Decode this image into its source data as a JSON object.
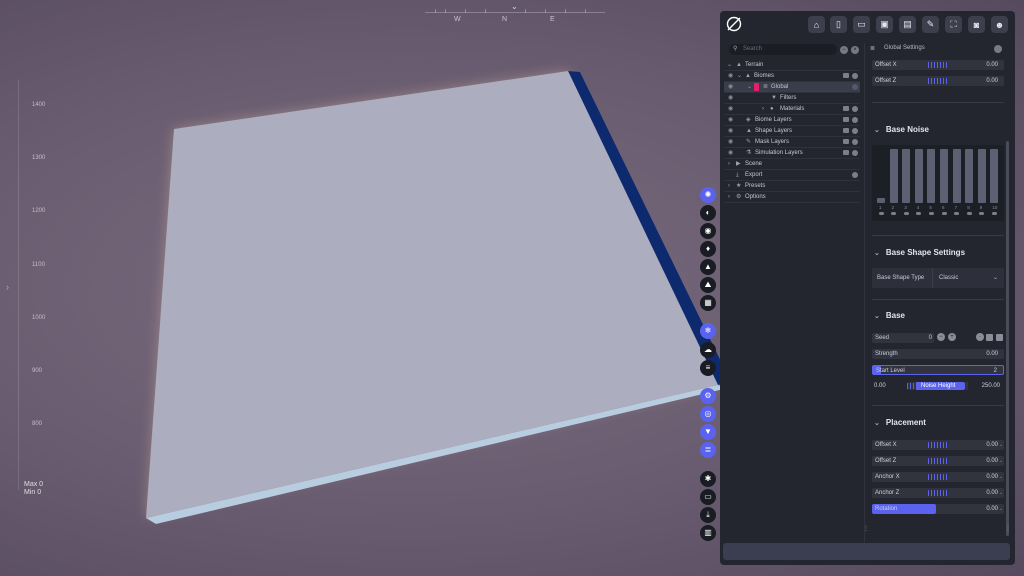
{
  "viewport": {
    "compass": {
      "west": "W",
      "north": "N",
      "east": "E"
    },
    "elevation_ticks": [
      "1400",
      "1300",
      "1200",
      "1100",
      "1000",
      "900",
      "800"
    ],
    "max_label": "Max 0",
    "min_label": "Min 0"
  },
  "search": {
    "placeholder": "Search"
  },
  "tree": {
    "items": [
      {
        "label": "Terrain",
        "icon": "mountain-icon"
      },
      {
        "label": "Biomes",
        "icon": "mountain-icon"
      },
      {
        "label": "Global",
        "icon": "layers-icon"
      },
      {
        "label": "Filters",
        "icon": "filter-icon"
      },
      {
        "label": "Materials",
        "icon": "sphere-icon"
      },
      {
        "label": "Biome Layers",
        "icon": "layers-icon"
      },
      {
        "label": "Shape Layers",
        "icon": "mountain-icon"
      },
      {
        "label": "Mask Layers",
        "icon": "brush-icon"
      },
      {
        "label": "Simulation Layers",
        "icon": "flask-icon"
      },
      {
        "label": "Scene",
        "icon": "camera-icon"
      },
      {
        "label": "Export",
        "icon": "download-icon"
      },
      {
        "label": "Presets",
        "icon": "star-icon"
      },
      {
        "label": "Options",
        "icon": "gear-icon"
      }
    ]
  },
  "props": {
    "title": "Global Settings",
    "top_offset_x": {
      "label": "Offset X",
      "value": "0.00"
    },
    "top_offset_z": {
      "label": "Offset Z",
      "value": "0.00"
    },
    "base_noise": {
      "title": "Base Noise",
      "octave_labels": [
        "1",
        "2",
        "3",
        "4",
        "5",
        "6",
        "7",
        "8",
        "9",
        "10"
      ],
      "octave_levels": [
        0.1,
        1,
        1,
        1,
        1,
        1,
        1,
        1,
        1,
        1
      ]
    },
    "base_shape": {
      "title": "Base Shape Settings",
      "type_label": "Base Shape Type",
      "type_value": "Classic"
    },
    "base": {
      "title": "Base",
      "seed_label": "Seed",
      "seed_value": "0",
      "strength_label": "Strength",
      "strength_value": "0.00",
      "start_level_label": "Start Level",
      "start_level_value": "2",
      "noise_height_label": "Noise Height",
      "noise_height_min": "0.00",
      "noise_height_max": "250.00"
    },
    "placement": {
      "title": "Placement",
      "offset_x": {
        "label": "Offset X",
        "value": "0.00"
      },
      "offset_z": {
        "label": "Offset Z",
        "value": "0.00"
      },
      "anchor_x": {
        "label": "Anchor X",
        "value": "0.00"
      },
      "anchor_z": {
        "label": "Anchor Z",
        "value": "0.00"
      },
      "rotation": {
        "label": "Rotation",
        "value": "0.00"
      }
    }
  },
  "colors": {
    "accent": "#5b63ee",
    "panel": "#24262f",
    "terrain": "#acadbe",
    "terrain_edge": "#0d2a6e"
  }
}
